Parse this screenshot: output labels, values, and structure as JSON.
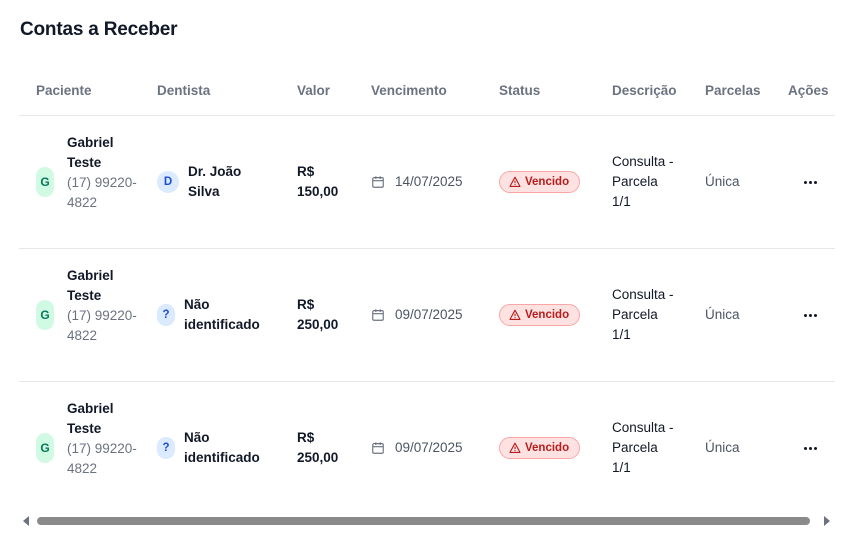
{
  "page": {
    "title": "Contas a Receber"
  },
  "table": {
    "headers": [
      "Paciente",
      "Dentista",
      "Valor",
      "Vencimento",
      "Status",
      "Descrição",
      "Parcelas",
      "Ações"
    ],
    "rows": [
      {
        "patient_initial": "G",
        "patient_name": "Gabriel Teste",
        "patient_phone": "(17) 99220-4822",
        "dentist_initial": "D",
        "dentist_name": "Dr. João Silva",
        "value": "R$ 150,00",
        "due_date": "14/07/2025",
        "status": "Vencido",
        "description": "Consulta - Parcela 1/1",
        "installments": "Única"
      },
      {
        "patient_initial": "G",
        "patient_name": "Gabriel Teste",
        "patient_phone": "(17) 99220-4822",
        "dentist_initial": "?",
        "dentist_name": "Não identificado",
        "value": "R$ 250,00",
        "due_date": "09/07/2025",
        "status": "Vencido",
        "description": "Consulta - Parcela 1/1",
        "installments": "Única"
      },
      {
        "patient_initial": "G",
        "patient_name": "Gabriel Teste",
        "patient_phone": "(17) 99220-4822",
        "dentist_initial": "?",
        "dentist_name": "Não identificado",
        "value": "R$ 250,00",
        "due_date": "09/07/2025",
        "status": "Vencido",
        "description": "Consulta - Parcela 1/1",
        "installments": "Única"
      }
    ]
  },
  "icons": {
    "due_date": "calendar-icon",
    "status": "warning-triangle-icon",
    "actions": "more-horizontal-icon"
  },
  "colors": {
    "status_overdue_bg": "#fee2e2",
    "status_overdue_text": "#b91c1c",
    "patient_avatar_bg": "#d1fae5",
    "dentist_avatar_bg": "#dbeafe"
  }
}
